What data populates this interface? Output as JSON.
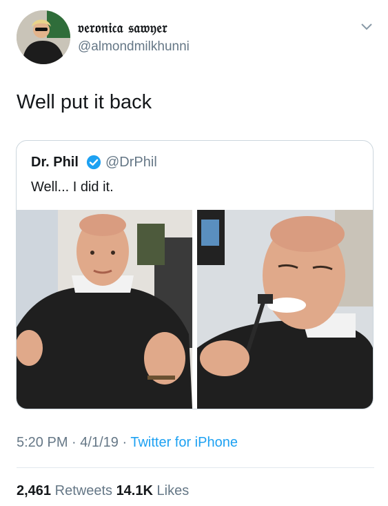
{
  "author": {
    "display_name": "𝔳𝔢𝔯𝔬𝔫𝔦𝔠𝔞 𝔰𝔞𝔴𝔶𝔢𝔯",
    "handle": "@almondmilkhunni"
  },
  "tweet": {
    "text": "Well put it back",
    "time": "5:20 PM",
    "date": "4/1/19",
    "source": "Twitter for iPhone",
    "separator": "·"
  },
  "quote": {
    "name": "Dr. Phil",
    "handle": "@DrPhil",
    "text": "Well... I did it."
  },
  "stats": {
    "retweets_count": "2,461",
    "retweets_label": "Retweets",
    "likes_count": "14.1K",
    "likes_label": "Likes"
  },
  "colors": {
    "link": "#1da1f2",
    "verified": "#1da1f2",
    "muted": "#657786",
    "text": "#14171a"
  },
  "icons": {
    "verified": "verified-badge-icon",
    "chevron": "chevron-down-icon"
  }
}
